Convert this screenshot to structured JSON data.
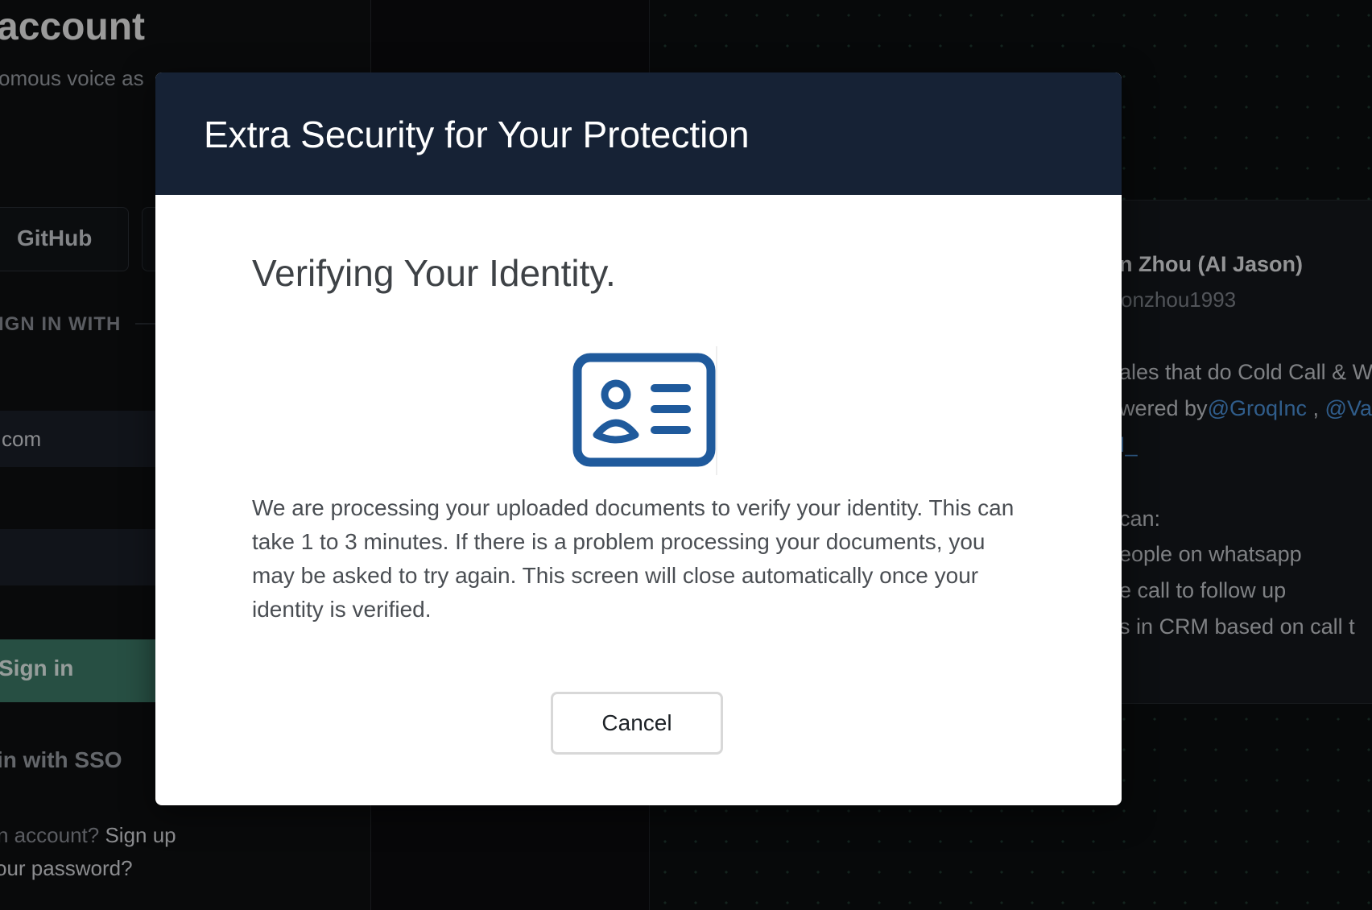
{
  "background": {
    "left_panel": {
      "heading": "account",
      "subtitle": "omous voice as",
      "github_button": "GitHub",
      "divider_label": "IGN IN WITH",
      "email_value": "com",
      "signin_button": "Sign in",
      "sso_link": "in with SSO",
      "signup_prompt": "n account?",
      "signup_link": "Sign up",
      "forgot_password": "our password?"
    },
    "testimonial": {
      "name": "n Zhou (AI Jason)",
      "handle": "onzhou1993",
      "line1": "ales that do Cold Call & W",
      "line2_prefix": "wered by",
      "line2_link1": "@GroqInc",
      "line2_sep": " , ",
      "line2_link2": "@Va",
      "line3_link": "I_",
      "line4": "can:",
      "line5": "eople on whatsapp",
      "line6": "e call to follow up",
      "line7": "s in CRM based on call t"
    }
  },
  "modal": {
    "title": "Extra Security for Your Protection",
    "heading": "Verifying Your Identity.",
    "icon": "id-card-icon",
    "icon_color": "#1f5a9c",
    "header_color": "#162235",
    "body": "We are processing your uploaded documents to verify your identity. This can take 1 to 3 minutes. If there is a problem processing your documents, you may be asked to try again. This screen will close automatically once your identity is verified.",
    "cancel_label": "Cancel"
  }
}
